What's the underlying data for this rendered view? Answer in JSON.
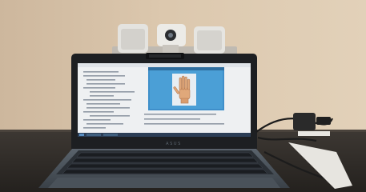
{
  "photo": {
    "subject": "laptop-with-webcam-hand-recognition",
    "colors": {
      "wall": "#d8c3a9",
      "desk": "#34302c",
      "laptop_body": "#4f5862",
      "bezel": "#1d1f22",
      "screen_white": "#eef0f2",
      "app_window_blue": "#4b9fd6",
      "taskbar": "#2c3e56"
    }
  },
  "laptop": {
    "brand_text": "ASUS"
  }
}
